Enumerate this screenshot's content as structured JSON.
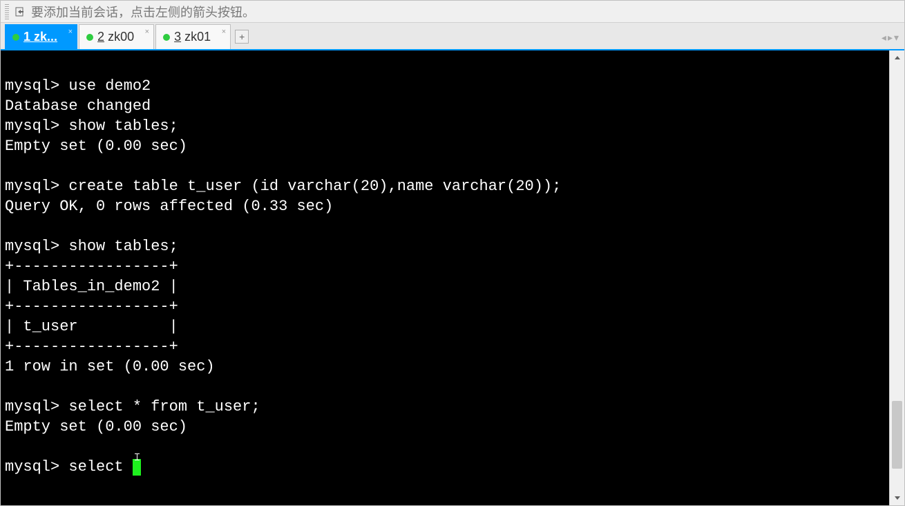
{
  "hint": {
    "text": "要添加当前会话，点击左侧的箭头按钮。"
  },
  "tabs": [
    {
      "num": "1",
      "label": "zk...",
      "active": true
    },
    {
      "num": "2",
      "label": "zk00",
      "active": false
    },
    {
      "num": "3",
      "label": "zk01",
      "active": false
    }
  ],
  "tab_add": "+",
  "terminal": {
    "lines": [
      "",
      "mysql> use demo2",
      "Database changed",
      "mysql> show tables;",
      "Empty set (0.00 sec)",
      "",
      "mysql> create table t_user (id varchar(20),name varchar(20));",
      "Query OK, 0 rows affected (0.33 sec)",
      "",
      "mysql> show tables;",
      "+-----------------+",
      "| Tables_in_demo2 |",
      "+-----------------+",
      "| t_user          |",
      "+-----------------+",
      "1 row in set (0.00 sec)",
      "",
      "mysql> select * from t_user;",
      "Empty set (0.00 sec)",
      ""
    ],
    "prompt_line_prefix": "mysql> select ",
    "cursor": true
  },
  "scrollbar": {
    "thumb_top_pct": 79,
    "thumb_height_pct": 16
  }
}
